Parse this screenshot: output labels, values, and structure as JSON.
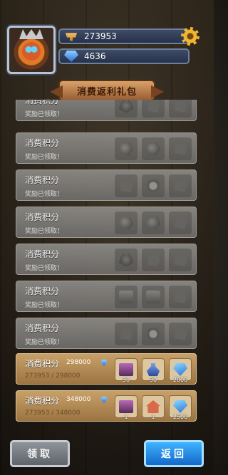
{
  "header": {
    "gold": "273953",
    "gems": "4636"
  },
  "title": "消费返利礼包",
  "rows": [
    {
      "status": "done",
      "label": "消费积分",
      "sub": "奖励已领取！"
    },
    {
      "status": "done",
      "label": "消费积分",
      "sub": "奖励已领取！"
    },
    {
      "status": "done",
      "label": "消费积分",
      "sub": "奖励已领取！"
    },
    {
      "status": "done",
      "label": "消费积分",
      "sub": "奖励已领取！"
    },
    {
      "status": "done",
      "label": "消费积分",
      "sub": "奖励已领取！"
    },
    {
      "status": "done",
      "label": "消费积分",
      "sub": "奖励已领取！"
    },
    {
      "status": "done",
      "label": "消费积分",
      "sub": "奖励已领取！"
    },
    {
      "status": "active",
      "label": "消费积分",
      "points": "298000",
      "progress": "273953 / 298000",
      "rewards": [
        {
          "icon": "card-icon",
          "count": "30"
        },
        {
          "icon": "potion-icon",
          "count": "30"
        },
        {
          "icon": "gem-icon",
          "count": "2000"
        }
      ]
    },
    {
      "status": "active",
      "label": "消费积分",
      "points": "348000",
      "progress": "273953 / 348000",
      "rewards": [
        {
          "icon": "card-icon",
          "count": "1"
        },
        {
          "icon": "hut-icon",
          "count": "1"
        },
        {
          "icon": "gem-icon",
          "count": "2500"
        }
      ]
    }
  ],
  "buttons": {
    "claim": "领取",
    "back": "返回"
  },
  "colors": {
    "claim_button": "#7a8087",
    "back_button": "#1e8ae6",
    "gold_icon": "#f2b530",
    "gem_icon": "#3a8ef0"
  }
}
